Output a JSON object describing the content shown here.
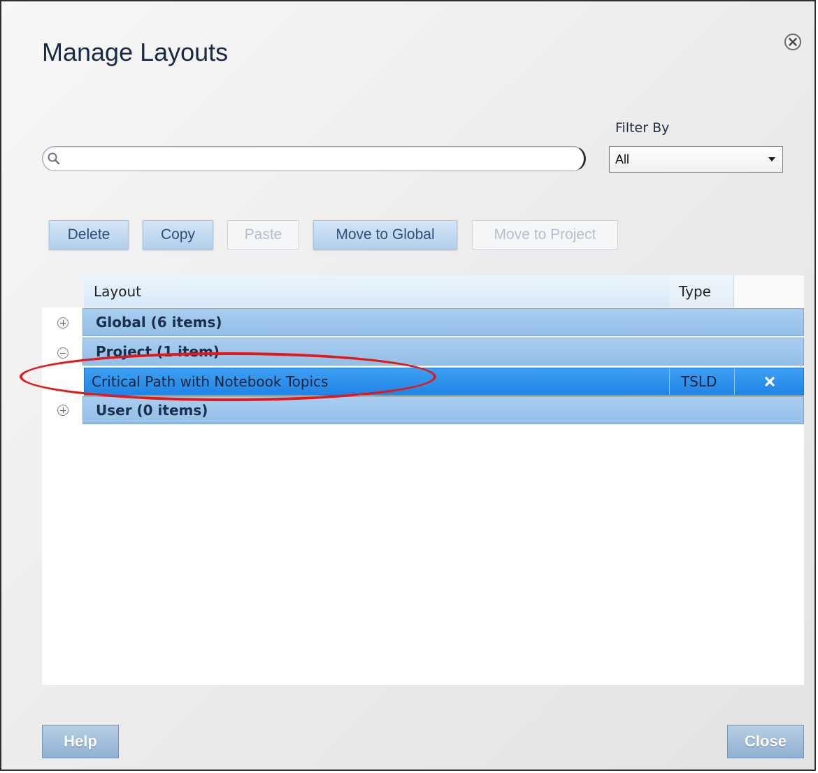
{
  "dialog": {
    "title": "Manage Layouts",
    "close_icon": "close-circle-icon"
  },
  "search": {
    "value": "",
    "placeholder": "",
    "icon": "search-icon"
  },
  "filter": {
    "label": "Filter By",
    "selected": "All"
  },
  "toolbar": {
    "delete_label": "Delete",
    "copy_label": "Copy",
    "paste_label": "Paste",
    "move_global_label": "Move to Global",
    "move_project_label": "Move to Project"
  },
  "grid": {
    "columns": {
      "layout": "Layout",
      "type": "Type"
    },
    "groups": [
      {
        "label": "Global (6 items)",
        "expanded": false
      },
      {
        "label": "Project (1 item)",
        "expanded": true
      },
      {
        "label": "User (0 items)",
        "expanded": false
      }
    ],
    "rows": [
      {
        "name": "Critical Path with Notebook Topics",
        "type": "TSLD",
        "action_icon": "delete-x-icon"
      }
    ]
  },
  "footer": {
    "help_label": "Help",
    "close_label": "Close"
  },
  "colors": {
    "accent": "#1f84e6",
    "group_row": "#a9cdf0",
    "annotation": "#e31818"
  }
}
